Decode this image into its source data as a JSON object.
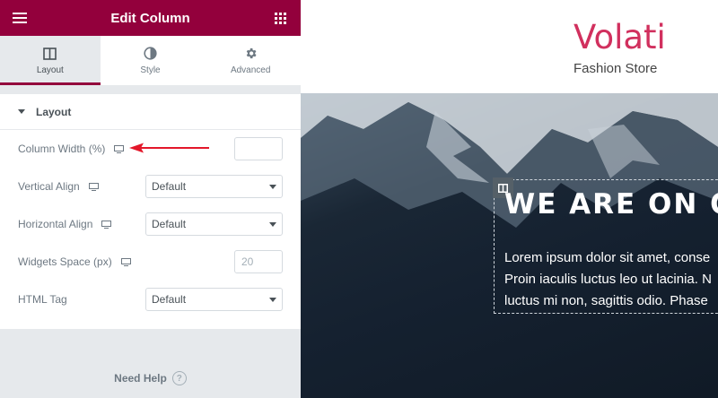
{
  "panel": {
    "title": "Edit Column",
    "tabs": [
      {
        "label": "Layout",
        "icon": "columns-icon"
      },
      {
        "label": "Style",
        "icon": "contrast-icon"
      },
      {
        "label": "Advanced",
        "icon": "gear-icon"
      }
    ],
    "section_title": "Layout",
    "controls": {
      "column_width": {
        "label": "Column Width (%)",
        "value": ""
      },
      "vertical_align": {
        "label": "Vertical Align",
        "value": "Default"
      },
      "horizontal_align": {
        "label": "Horizontal Align",
        "value": "Default"
      },
      "widgets_space": {
        "label": "Widgets Space (px)",
        "placeholder": "20"
      },
      "html_tag": {
        "label": "HTML Tag",
        "value": "Default"
      }
    },
    "help_label": "Need Help",
    "accent_color": "#93003c"
  },
  "preview": {
    "brand_name": "Volati",
    "brand_tagline": "Fashion Store",
    "headline": "WE ARE ON OU",
    "body_lines": [
      "Lorem ipsum dolor sit amet, conse",
      "Proin iaculis luctus leo ut lacinia. N",
      "luctus mi non, sagittis odio. Phase"
    ],
    "brand_color": "#d1305e"
  }
}
